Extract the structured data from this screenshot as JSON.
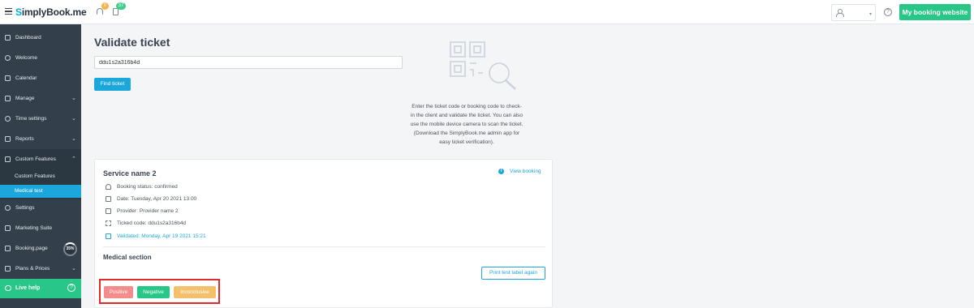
{
  "topbar": {
    "logo_prefix": "S",
    "logo_rest": "implyBook.me",
    "notifications_count": "0",
    "tasks_count": "37",
    "booking_website_label": "My booking website"
  },
  "sidebar": {
    "items": [
      {
        "label": "Dashboard"
      },
      {
        "label": "Welcome"
      },
      {
        "label": "Calendar"
      },
      {
        "label": "Manage"
      },
      {
        "label": "Time settings"
      },
      {
        "label": "Reports"
      },
      {
        "label": "Custom Features"
      },
      {
        "label": "Settings"
      },
      {
        "label": "Marketing Suite"
      },
      {
        "label": "Booking.page"
      },
      {
        "label": "Plans & Prices"
      }
    ],
    "sub_items": [
      {
        "label": "Custom Features"
      },
      {
        "label": "Medical test"
      }
    ],
    "booking_page_progress": "35%",
    "live_help_label": "Live help"
  },
  "main": {
    "title": "Validate ticket",
    "ticket_input_value": "ddu1s2a316b4d",
    "find_button_label": "Find ticket",
    "help_text": "Enter the ticket code or booking code to check-in the client and validate the ticket. You can also use the mobile device camera to scan the ticket. (Download the SimplyBook.me admin app for easy ticket verification)."
  },
  "card": {
    "title": "Service name 2",
    "view_booking_label": "View booking",
    "details": [
      {
        "icon": "home-icon",
        "text": "Booking status: confirmed"
      },
      {
        "icon": "calendar-icon",
        "text": "Date: Tuesday, Apr 20 2021 13:00"
      },
      {
        "icon": "provider-icon",
        "text": "Provider: Provider name 2"
      },
      {
        "icon": "qr-icon",
        "text": "Ticked code: ddu1s2a316b4d"
      },
      {
        "icon": "folder-icon",
        "text": "Validated: Monday, Apr 19 2021 15:21"
      }
    ],
    "section_title": "Medical section",
    "print_button_label": "Print test label again",
    "results": {
      "positive": "Positive",
      "negative": "Negative",
      "inconclusive": "Inconclusive"
    }
  },
  "colors": {
    "accent": "#1ba7dc",
    "green": "#28c687",
    "sidebar": "#333f4a",
    "positive": "#f58c8c",
    "inconclusive": "#f5c06b",
    "highlight": "#e32a2a"
  }
}
